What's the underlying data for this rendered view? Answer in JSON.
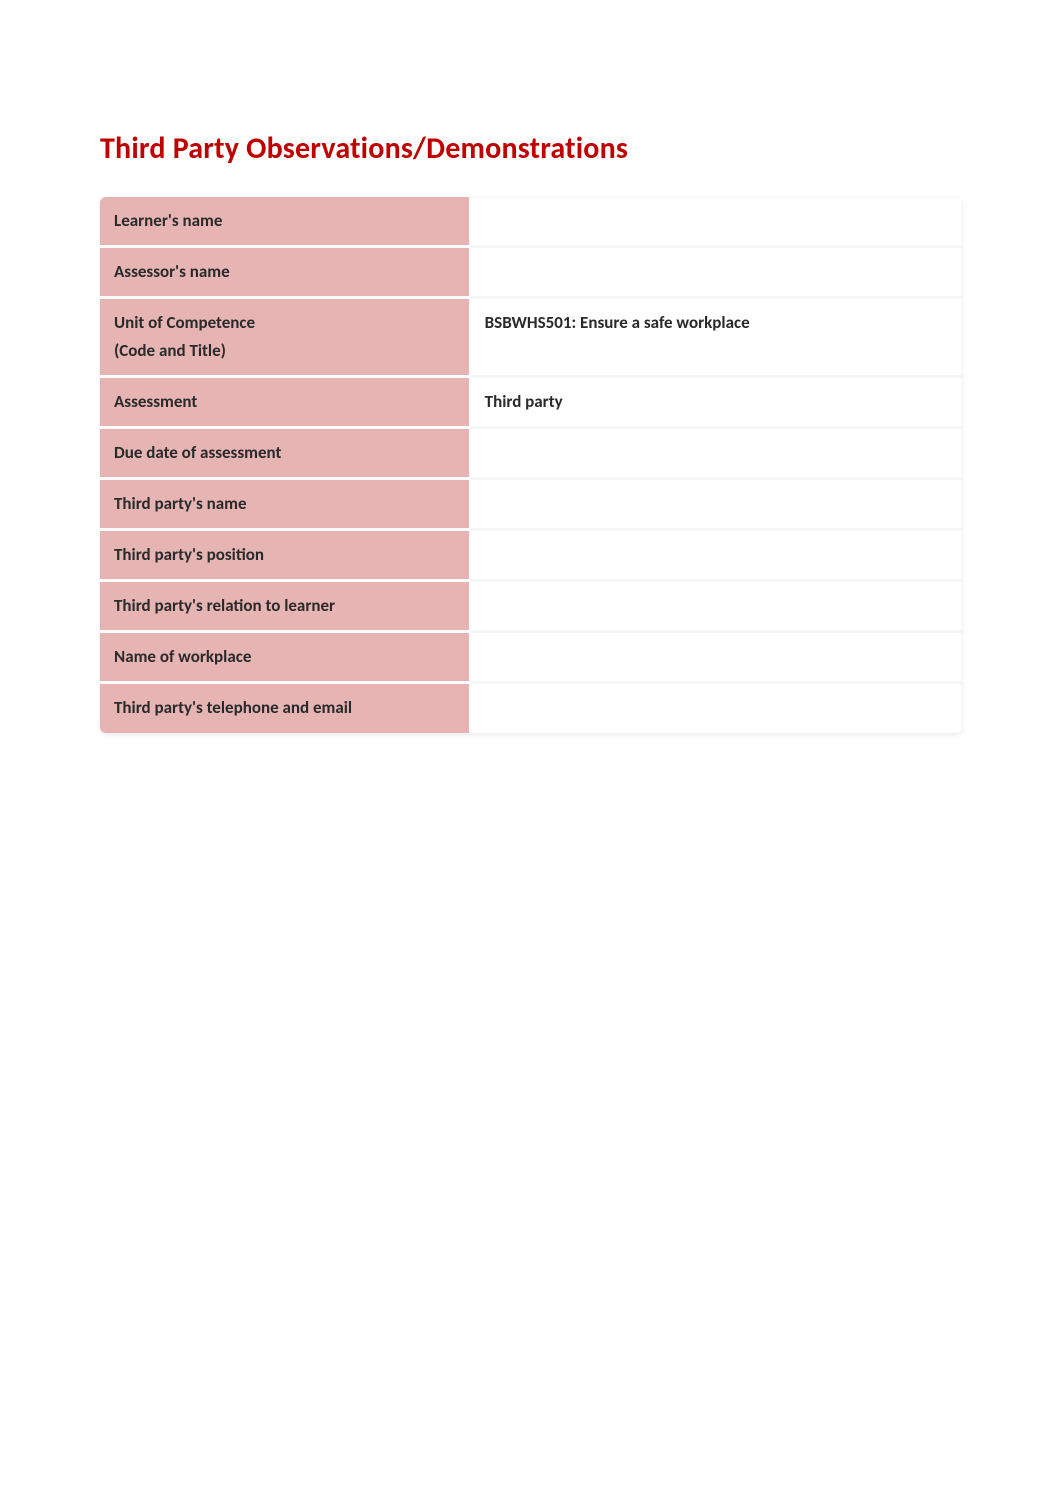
{
  "title": "Third Party Observations/Demonstrations",
  "rows": [
    {
      "label": "Learner's name",
      "value": ""
    },
    {
      "label": "Assessor's name",
      "value": ""
    },
    {
      "label": "Unit of Competence\n(Code and Title)",
      "value": "BSBWHS501: Ensure a safe workplace"
    },
    {
      "label": "Assessment",
      "value": "Third party"
    },
    {
      "label": "Due date of assessment",
      "value": ""
    },
    {
      "label": "Third party's name",
      "value": ""
    },
    {
      "label": "Third party's position",
      "value": ""
    },
    {
      "label": "Third party's relation to learner",
      "value": ""
    },
    {
      "label": "Name of workplace",
      "value": ""
    },
    {
      "label": "Third party's telephone and email",
      "value": ""
    }
  ]
}
